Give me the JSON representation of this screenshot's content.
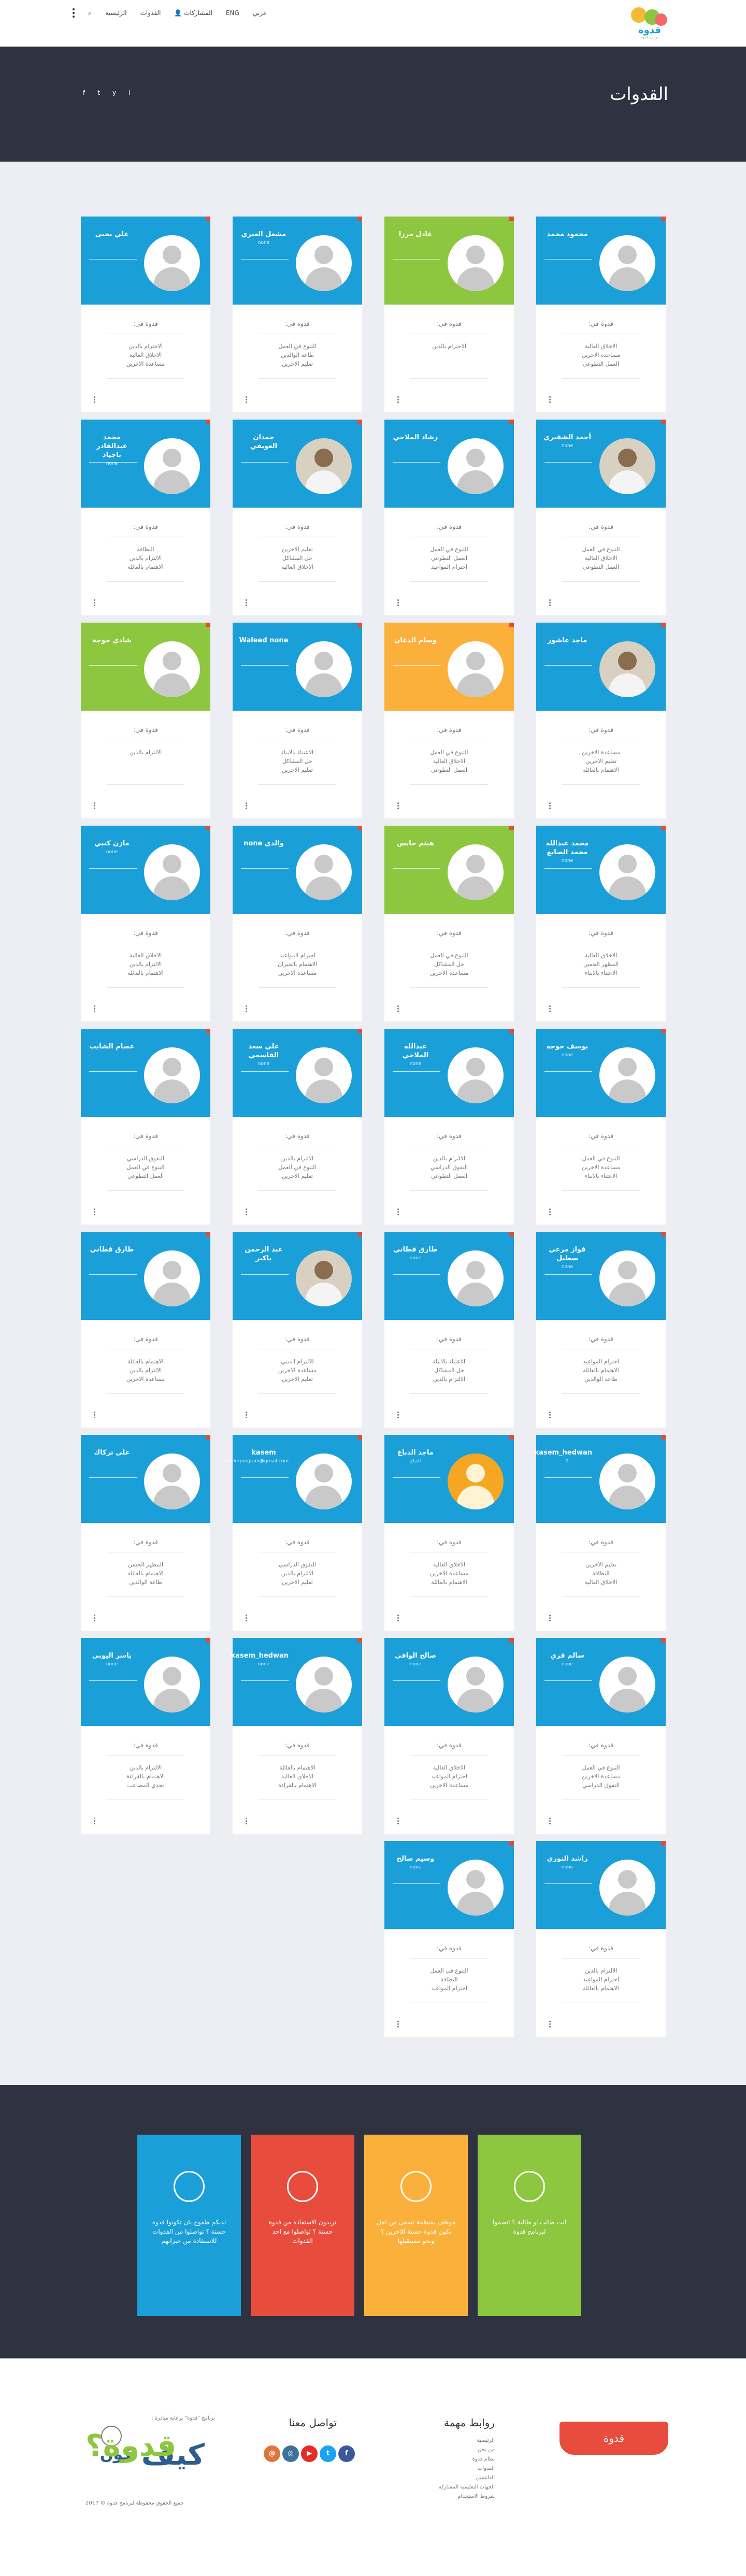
{
  "header": {
    "logo_text": "قدوة",
    "logo_sub": "برنامج قدوة",
    "nav": {
      "lang": "عربي",
      "lang_flag": "ENG",
      "posts": "المشاركات",
      "models": "القدوات",
      "home": "الرئيسية"
    }
  },
  "hero": {
    "title": "القدوات"
  },
  "socials": [
    "f",
    "t",
    "y",
    "i"
  ],
  "cards": [
    {
      "name": "محمود محمد",
      "sub": "",
      "color": "#1a9fd9",
      "avatar": "default",
      "title": "قدوة في:",
      "traits": [
        "الاخلاق العالية",
        "مساعدة الاخرين",
        "العمل التطوعي"
      ]
    },
    {
      "name": "عادل مرزا",
      "sub": "",
      "color": "#8dc63f",
      "avatar": "default",
      "title": "قدوة في:",
      "traits": [
        "الاحترام بالدين"
      ]
    },
    {
      "name": "مشعل العنزي",
      "sub": "none",
      "color": "#1a9fd9",
      "avatar": "default",
      "title": "قدوة في:",
      "traits": [
        "التنوع في العمل",
        "طاعة الوالدين",
        "تعليم الاخرين"
      ]
    },
    {
      "name": "علي يحيى",
      "sub": "",
      "color": "#1a9fd9",
      "avatar": "default",
      "title": "قدوة في:",
      "traits": [
        "الاحترام بالدين",
        "الاخلاق العالية",
        "مساعدة الاخرين"
      ]
    },
    {
      "name": "أحمد الشقيري",
      "sub": "none",
      "color": "#1a9fd9",
      "avatar": "photo",
      "title": "قدوة في:",
      "traits": [
        "التنوع في العمل",
        "الاخلاق العالية",
        "العمل التطوعي"
      ]
    },
    {
      "name": "رشاد الملاحي",
      "sub": "",
      "color": "#1a9fd9",
      "avatar": "default",
      "title": "قدوة في:",
      "traits": [
        "التنوع في العمل",
        "العمل التطوعي",
        "احترام المواعيد"
      ]
    },
    {
      "name": "حمدان العويفي",
      "sub": "",
      "color": "#1a9fd9",
      "avatar": "photo",
      "title": "قدوة في:",
      "traits": [
        "تعليم الاخرين",
        "حل المشاكل",
        "الاخلاق العالية"
      ]
    },
    {
      "name": "محمد عبدالقادر باجياد",
      "sub": "none",
      "color": "#1a9fd9",
      "avatar": "default",
      "title": "قدوة في:",
      "traits": [
        "النظافة",
        "الالتزام بالدين",
        "الاهتمام بالعائلة"
      ]
    },
    {
      "name": "ماجد عاشور",
      "sub": "",
      "color": "#1a9fd9",
      "avatar": "photo",
      "title": "قدوة في:",
      "traits": [
        "مساعدة الاخرين",
        "تعليم الاخرين",
        "الاهتمام بالعائلة"
      ]
    },
    {
      "name": "وسام الدغان",
      "sub": "",
      "color": "#fbb03b",
      "avatar": "default",
      "title": "قدوة في:",
      "traits": [
        "التنوع في العمل",
        "الاخلاق العالية",
        "العمل التطوعي"
      ]
    },
    {
      "name": "Waleed none",
      "sub": "",
      "color": "#1a9fd9",
      "avatar": "default",
      "title": "قدوة في:",
      "traits": [
        "الاعتناء بالابناء",
        "حل المشاكل",
        "تعليم الاخرين"
      ]
    },
    {
      "name": "شادي خوجة",
      "sub": "",
      "color": "#8dc63f",
      "avatar": "default",
      "title": "قدوة في:",
      "traits": [
        "الالتزام بالدين"
      ]
    },
    {
      "name": "محمد عبدالله محمد الصايغ",
      "sub": "none",
      "color": "#1a9fd9",
      "avatar": "default",
      "title": "قدوة في:",
      "traits": [
        "الاخلاق العالية",
        "المظهر الحسن",
        "الاعتناء بالابناء"
      ]
    },
    {
      "name": "هيثم حابس",
      "sub": "",
      "color": "#8dc63f",
      "avatar": "default",
      "title": "قدوة في:",
      "traits": [
        "التنوع في العمل",
        "حل المشاكل",
        "مساعدة الاخرين"
      ]
    },
    {
      "name": "والدي none",
      "sub": "",
      "color": "#1a9fd9",
      "avatar": "default",
      "title": "قدوة في:",
      "traits": [
        "احترام المواعيد",
        "الاهتمام بالجيران",
        "مساعدة الاخرين"
      ]
    },
    {
      "name": "مازن كتبي",
      "sub": "none",
      "color": "#1a9fd9",
      "avatar": "default",
      "title": "قدوة في:",
      "traits": [
        "الاخلاق العالية",
        "الالتزام بالدين",
        "الاهتمام بالعائلة"
      ]
    },
    {
      "name": "يوسف خوجه",
      "sub": "none",
      "color": "#1a9fd9",
      "avatar": "default",
      "title": "قدوة في:",
      "traits": [
        "التنوع في العمل",
        "مساعدة الاخرين",
        "الاعتناء بالابناء"
      ]
    },
    {
      "name": "عبدالله الملاحي",
      "sub": "none",
      "color": "#1a9fd9",
      "avatar": "default",
      "title": "قدوة في:",
      "traits": [
        "الالتزام بالدين",
        "التفوق الدراسي",
        "العمل التطوعي"
      ]
    },
    {
      "name": "علي سعد القاسمي",
      "sub": "none",
      "color": "#1a9fd9",
      "avatar": "default",
      "title": "قدوة في:",
      "traits": [
        "الالتزام بالدين",
        "التنوع في العمل",
        "تعليم الاخرين"
      ]
    },
    {
      "name": "عصام الشايب",
      "sub": "",
      "color": "#1a9fd9",
      "avatar": "default",
      "title": "قدوة في:",
      "traits": [
        "التفوق الدراسي",
        "التنوع في العمل",
        "العمل التطوعي"
      ]
    },
    {
      "name": "فواز مرعي سطيل",
      "sub": "none",
      "color": "#1a9fd9",
      "avatar": "default",
      "title": "قدوة في:",
      "traits": [
        "احترام المواعيد",
        "الاهتمام بالعائلة",
        "طاعة الوالدين"
      ]
    },
    {
      "name": "طارق فطاني",
      "sub": "none",
      "color": "#1a9fd9",
      "avatar": "default",
      "title": "قدوة في:",
      "traits": [
        "الاعتناء بالابناء",
        "حل المشاكل",
        "الالتزام بالدين"
      ]
    },
    {
      "name": "عبد الرحمن باكير",
      "sub": "",
      "color": "#1a9fd9",
      "avatar": "photo",
      "title": "قدوة في:",
      "traits": [
        "الالتزام الديني",
        "مساعدة الاخرين",
        "تعليم الاخرين"
      ]
    },
    {
      "name": "طارق فطاني",
      "sub": "",
      "color": "#1a9fd9",
      "avatar": "default",
      "title": "قدوة في:",
      "traits": [
        "الاهتمام بالعائلة",
        "الالتزام بالدين",
        "مساعدة الاخرين"
      ]
    },
    {
      "name": "kasem_hedwan",
      "sub": "2",
      "color": "#1a9fd9",
      "avatar": "default",
      "title": "قدوة في:",
      "traits": [
        "تعليم الاخرين",
        "النظافة",
        "الاخلاق العالية"
      ]
    },
    {
      "name": "ماجد الدباغ",
      "sub": "الدباغ",
      "color": "#1a9fd9",
      "avatar": "orange",
      "title": "قدوة في:",
      "traits": [
        "الاخلاق العالية",
        "مساعدة الاخرين",
        "الاهتمام بالعائلة"
      ]
    },
    {
      "name": "kasem",
      "sub": "kaderprogram@gmail.com",
      "color": "#1a9fd9",
      "avatar": "default",
      "title": "قدوة في:",
      "traits": [
        "التفوق الدراسي",
        "الالتزام بالدين",
        "تعليم الاخرين"
      ]
    },
    {
      "name": "علي تركاك",
      "sub": "",
      "color": "#1a9fd9",
      "avatar": "default",
      "title": "قدوة في:",
      "traits": [
        "المظهر الحسن",
        "الاهتمام بالعائلة",
        "طاعة الوالدين"
      ]
    },
    {
      "name": "سالم قري",
      "sub": "none",
      "color": "#1a9fd9",
      "avatar": "default",
      "title": "قدوة في:",
      "traits": [
        "التنوع في العمل",
        "مساعدة الاخرين",
        "التفوق الدراسي"
      ]
    },
    {
      "name": "صالح الوافي",
      "sub": "none",
      "color": "#1a9fd9",
      "avatar": "default",
      "title": "قدوة في:",
      "traits": [
        "الاخلاق العالية",
        "احترام المواعيد",
        "مساعدة الاخرين"
      ]
    },
    {
      "name": "kasem_hedwan",
      "sub": "none",
      "color": "#1a9fd9",
      "avatar": "default",
      "title": "قدوة في:",
      "traits": [
        "الاهتمام بالعائلة",
        "الاخلاق العالية",
        "الاهتمام بالقراءة"
      ]
    },
    {
      "name": "ياسر اليوبي",
      "sub": "none",
      "color": "#1a9fd9",
      "avatar": "default",
      "title": "قدوة في:",
      "traits": [
        "الالتزام بالدين",
        "الاهتمام بالقراءة",
        "تحدي المصاعب"
      ]
    },
    {
      "name": "راشد النوري",
      "sub": "none",
      "color": "#1a9fd9",
      "avatar": "default",
      "title": "قدوة في:",
      "traits": [
        "الالتزام بالدين",
        "احترام المواعيد",
        "الاهتمام بالعائلة"
      ]
    },
    {
      "name": "وسيم صالح",
      "sub": "none",
      "color": "#1a9fd9",
      "avatar": "default",
      "title": "قدوة في:",
      "traits": [
        "التنوع في العمل",
        "النظافة",
        "احترام المواعيد"
      ]
    }
  ],
  "features": [
    {
      "color": "#8dc63f",
      "icon": "woman-icon",
      "text": "انت طالب او طالبة ؟ انضموا لبرنامج قدوة"
    },
    {
      "color": "#fbb03b",
      "icon": "profile-icon",
      "text": "موظف بمنظمة تسعى من اجل تكون قدوة حسنة للاخرين ؟ ونحو مستقبلها"
    },
    {
      "color": "#e74c3c",
      "icon": "chat-icon",
      "text": "تريدون الاستفادة من قدوة حسنة ؟ تواصلوا مع احد القدوات"
    },
    {
      "color": "#1a9fd9",
      "icon": "group-icon",
      "text": "لديكم طموح بان تكونوا قدوة حسنة ؟ تواصلوا من القدوات للاستفادة من خبراتهم"
    }
  ],
  "footer": {
    "button": "قدوة",
    "links_title": "روابط مهمة",
    "links": [
      "الرئيسية",
      "من نحن",
      "نظام قدوة",
      "القدوات",
      "الداعمين",
      "الجهات التعليمية المشاركة",
      "شروط الاستخدام"
    ],
    "contact_title": "تواصل معنا",
    "contact_icons": [
      {
        "name": "facebook-icon",
        "glyph": "f",
        "color": "#3b5998"
      },
      {
        "name": "twitter-icon",
        "glyph": "t",
        "color": "#1da1f2"
      },
      {
        "name": "youtube-icon",
        "glyph": "▶",
        "color": "#e52d27"
      },
      {
        "name": "instagram-icon",
        "glyph": "◎",
        "color": "#3f729b"
      },
      {
        "name": "email-icon",
        "glyph": "@",
        "color": "#e2743a"
      }
    ],
    "tagline": "برنامج \"قدوة\" برعاية مبادرة :",
    "kayf": "كيف",
    "kayf2": "نكون",
    "q": "قدوة؟",
    "copyright": "جميع الحقوق محفوظة لبرنامج قدوة © 2017"
  }
}
